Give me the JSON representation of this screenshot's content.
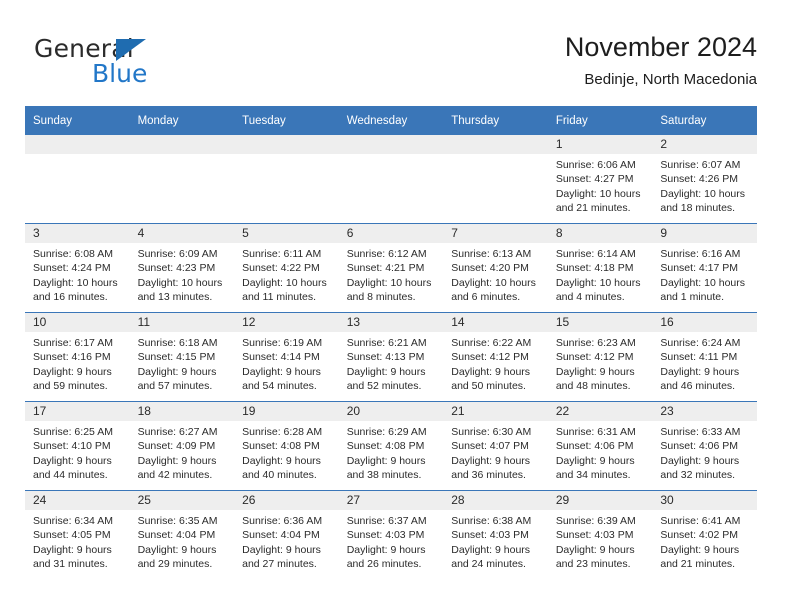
{
  "brand": {
    "word_one": "General",
    "word_two": "Blue",
    "icon": "triangle-logo-icon",
    "color_dark": "#2b2b2b",
    "color_blue": "#2277c8"
  },
  "header": {
    "title": "November 2024",
    "subtitle": "Bedinje, North Macedonia"
  },
  "theme": {
    "header_blue": "#3a76b8",
    "daynum_gray": "#eeeeee",
    "text": "#2b2b2b"
  },
  "weekdays": [
    "Sunday",
    "Monday",
    "Tuesday",
    "Wednesday",
    "Thursday",
    "Friday",
    "Saturday"
  ],
  "weeks": [
    [
      {
        "day": "",
        "lines": []
      },
      {
        "day": "",
        "lines": []
      },
      {
        "day": "",
        "lines": []
      },
      {
        "day": "",
        "lines": []
      },
      {
        "day": "",
        "lines": []
      },
      {
        "day": "1",
        "lines": [
          "Sunrise: 6:06 AM",
          "Sunset: 4:27 PM",
          "Daylight: 10 hours",
          "and 21 minutes."
        ]
      },
      {
        "day": "2",
        "lines": [
          "Sunrise: 6:07 AM",
          "Sunset: 4:26 PM",
          "Daylight: 10 hours",
          "and 18 minutes."
        ]
      }
    ],
    [
      {
        "day": "3",
        "lines": [
          "Sunrise: 6:08 AM",
          "Sunset: 4:24 PM",
          "Daylight: 10 hours",
          "and 16 minutes."
        ]
      },
      {
        "day": "4",
        "lines": [
          "Sunrise: 6:09 AM",
          "Sunset: 4:23 PM",
          "Daylight: 10 hours",
          "and 13 minutes."
        ]
      },
      {
        "day": "5",
        "lines": [
          "Sunrise: 6:11 AM",
          "Sunset: 4:22 PM",
          "Daylight: 10 hours",
          "and 11 minutes."
        ]
      },
      {
        "day": "6",
        "lines": [
          "Sunrise: 6:12 AM",
          "Sunset: 4:21 PM",
          "Daylight: 10 hours",
          "and 8 minutes."
        ]
      },
      {
        "day": "7",
        "lines": [
          "Sunrise: 6:13 AM",
          "Sunset: 4:20 PM",
          "Daylight: 10 hours",
          "and 6 minutes."
        ]
      },
      {
        "day": "8",
        "lines": [
          "Sunrise: 6:14 AM",
          "Sunset: 4:18 PM",
          "Daylight: 10 hours",
          "and 4 minutes."
        ]
      },
      {
        "day": "9",
        "lines": [
          "Sunrise: 6:16 AM",
          "Sunset: 4:17 PM",
          "Daylight: 10 hours",
          "and 1 minute."
        ]
      }
    ],
    [
      {
        "day": "10",
        "lines": [
          "Sunrise: 6:17 AM",
          "Sunset: 4:16 PM",
          "Daylight: 9 hours",
          "and 59 minutes."
        ]
      },
      {
        "day": "11",
        "lines": [
          "Sunrise: 6:18 AM",
          "Sunset: 4:15 PM",
          "Daylight: 9 hours",
          "and 57 minutes."
        ]
      },
      {
        "day": "12",
        "lines": [
          "Sunrise: 6:19 AM",
          "Sunset: 4:14 PM",
          "Daylight: 9 hours",
          "and 54 minutes."
        ]
      },
      {
        "day": "13",
        "lines": [
          "Sunrise: 6:21 AM",
          "Sunset: 4:13 PM",
          "Daylight: 9 hours",
          "and 52 minutes."
        ]
      },
      {
        "day": "14",
        "lines": [
          "Sunrise: 6:22 AM",
          "Sunset: 4:12 PM",
          "Daylight: 9 hours",
          "and 50 minutes."
        ]
      },
      {
        "day": "15",
        "lines": [
          "Sunrise: 6:23 AM",
          "Sunset: 4:12 PM",
          "Daylight: 9 hours",
          "and 48 minutes."
        ]
      },
      {
        "day": "16",
        "lines": [
          "Sunrise: 6:24 AM",
          "Sunset: 4:11 PM",
          "Daylight: 9 hours",
          "and 46 minutes."
        ]
      }
    ],
    [
      {
        "day": "17",
        "lines": [
          "Sunrise: 6:25 AM",
          "Sunset: 4:10 PM",
          "Daylight: 9 hours",
          "and 44 minutes."
        ]
      },
      {
        "day": "18",
        "lines": [
          "Sunrise: 6:27 AM",
          "Sunset: 4:09 PM",
          "Daylight: 9 hours",
          "and 42 minutes."
        ]
      },
      {
        "day": "19",
        "lines": [
          "Sunrise: 6:28 AM",
          "Sunset: 4:08 PM",
          "Daylight: 9 hours",
          "and 40 minutes."
        ]
      },
      {
        "day": "20",
        "lines": [
          "Sunrise: 6:29 AM",
          "Sunset: 4:08 PM",
          "Daylight: 9 hours",
          "and 38 minutes."
        ]
      },
      {
        "day": "21",
        "lines": [
          "Sunrise: 6:30 AM",
          "Sunset: 4:07 PM",
          "Daylight: 9 hours",
          "and 36 minutes."
        ]
      },
      {
        "day": "22",
        "lines": [
          "Sunrise: 6:31 AM",
          "Sunset: 4:06 PM",
          "Daylight: 9 hours",
          "and 34 minutes."
        ]
      },
      {
        "day": "23",
        "lines": [
          "Sunrise: 6:33 AM",
          "Sunset: 4:06 PM",
          "Daylight: 9 hours",
          "and 32 minutes."
        ]
      }
    ],
    [
      {
        "day": "24",
        "lines": [
          "Sunrise: 6:34 AM",
          "Sunset: 4:05 PM",
          "Daylight: 9 hours",
          "and 31 minutes."
        ]
      },
      {
        "day": "25",
        "lines": [
          "Sunrise: 6:35 AM",
          "Sunset: 4:04 PM",
          "Daylight: 9 hours",
          "and 29 minutes."
        ]
      },
      {
        "day": "26",
        "lines": [
          "Sunrise: 6:36 AM",
          "Sunset: 4:04 PM",
          "Daylight: 9 hours",
          "and 27 minutes."
        ]
      },
      {
        "day": "27",
        "lines": [
          "Sunrise: 6:37 AM",
          "Sunset: 4:03 PM",
          "Daylight: 9 hours",
          "and 26 minutes."
        ]
      },
      {
        "day": "28",
        "lines": [
          "Sunrise: 6:38 AM",
          "Sunset: 4:03 PM",
          "Daylight: 9 hours",
          "and 24 minutes."
        ]
      },
      {
        "day": "29",
        "lines": [
          "Sunrise: 6:39 AM",
          "Sunset: 4:03 PM",
          "Daylight: 9 hours",
          "and 23 minutes."
        ]
      },
      {
        "day": "30",
        "lines": [
          "Sunrise: 6:41 AM",
          "Sunset: 4:02 PM",
          "Daylight: 9 hours",
          "and 21 minutes."
        ]
      }
    ]
  ]
}
